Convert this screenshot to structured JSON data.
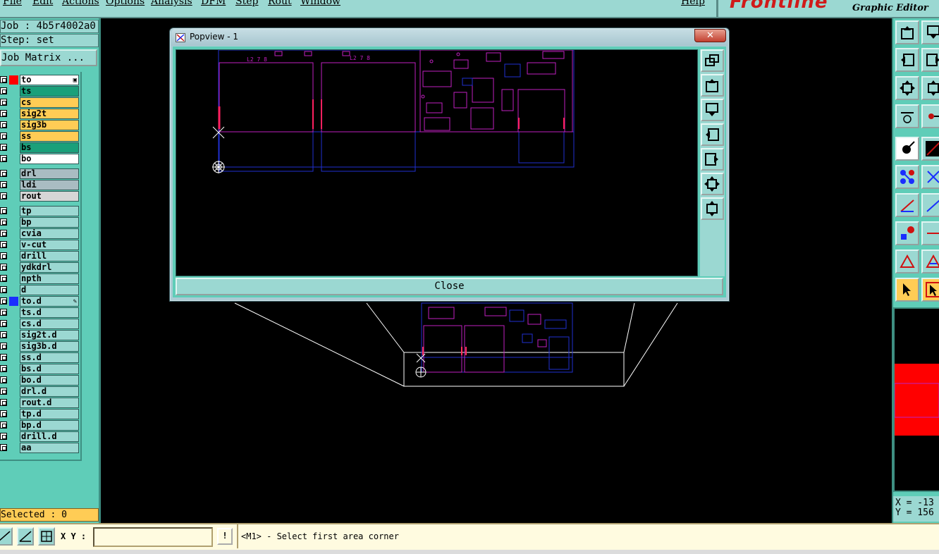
{
  "menu": [
    "File",
    "Edit",
    "Actions",
    "Options",
    "Analysis",
    "DFM",
    "Step",
    "Rout",
    "Window",
    "Help"
  ],
  "logo": {
    "brand": "Frontline",
    "subtitle": "Graphic Editor"
  },
  "job": {
    "job_line": "Job : 4b5r4002a0",
    "step_line": "Step: set",
    "matrix_button": "Job Matrix ..."
  },
  "layers": [
    {
      "name": "to",
      "color": "#ffffff",
      "swatch": "#ff0000"
    },
    {
      "name": "ts",
      "color": "#1aa07a"
    },
    {
      "name": "cs",
      "color": "#ffcc55"
    },
    {
      "name": "sig2t",
      "color": "#ffcc55"
    },
    {
      "name": "sig3b",
      "color": "#ffcc55"
    },
    {
      "name": "ss",
      "color": "#ffcc55"
    },
    {
      "name": "bs",
      "color": "#1aa07a"
    },
    {
      "name": "bo",
      "color": "#ffffff"
    },
    {
      "name": "drl",
      "color": "#a9bcc2"
    },
    {
      "name": "ldi",
      "color": "#a9bcc2"
    },
    {
      "name": "rout",
      "color": "#d6d6d6"
    },
    {
      "name": "tp",
      "color": "#9bd8d2"
    },
    {
      "name": "bp",
      "color": "#9bd8d2"
    },
    {
      "name": "cvia",
      "color": "#9bd8d2"
    },
    {
      "name": "v-cut",
      "color": "#9bd8d2"
    },
    {
      "name": "drill",
      "color": "#9bd8d2"
    },
    {
      "name": "ydkdrl",
      "color": "#9bd8d2"
    },
    {
      "name": "npth",
      "color": "#9bd8d2"
    },
    {
      "name": "d",
      "color": "#9bd8d2"
    },
    {
      "name": "to.d",
      "color": "#9bd8d2",
      "swatch": "#1a2eff"
    },
    {
      "name": "ts.d",
      "color": "#9bd8d2"
    },
    {
      "name": "cs.d",
      "color": "#9bd8d2"
    },
    {
      "name": "sig2t.d",
      "color": "#9bd8d2"
    },
    {
      "name": "sig3b.d",
      "color": "#9bd8d2"
    },
    {
      "name": "ss.d",
      "color": "#9bd8d2"
    },
    {
      "name": "bs.d",
      "color": "#9bd8d2"
    },
    {
      "name": "bo.d",
      "color": "#9bd8d2"
    },
    {
      "name": "drl.d",
      "color": "#9bd8d2"
    },
    {
      "name": "rout.d",
      "color": "#9bd8d2"
    },
    {
      "name": "tp.d",
      "color": "#9bd8d2"
    },
    {
      "name": "bp.d",
      "color": "#9bd8d2"
    },
    {
      "name": "drill.d",
      "color": "#9bd8d2"
    },
    {
      "name": "aa",
      "color": "#9bd8d2"
    }
  ],
  "selected": "Selected : 0",
  "popview": {
    "title": "Popview - 1",
    "close_x": "✕",
    "close_label": "Close"
  },
  "coords": {
    "x": "X = -13",
    "y": "Y = 156"
  },
  "status": {
    "xy_label": "X Y :",
    "xy_value": "",
    "msg_icon": "!",
    "prompt": "<M1> - Select first area corner"
  },
  "colors": {
    "panel": "#5fcdb8",
    "button": "#9bd8d2",
    "highlight": "#ffcc55",
    "pcb_magenta": "#c020c0",
    "pcb_blue": "#2030d0"
  }
}
